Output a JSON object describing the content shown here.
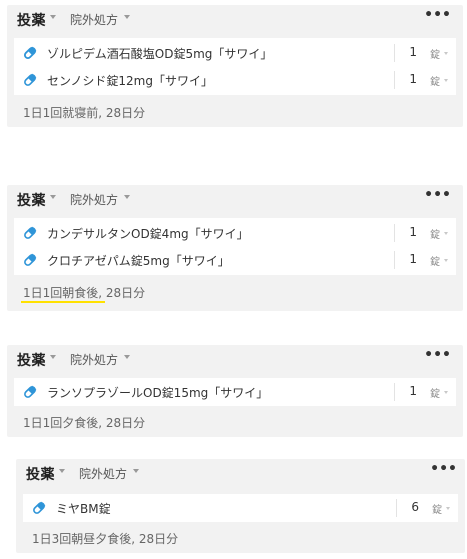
{
  "cards": [
    {
      "title": "投薬",
      "type": "院外処方",
      "more": "•••",
      "drugs": [
        {
          "icon": "pill-icon",
          "name": "ゾルピデム酒石酸塩OD錠5mg「サワイ」",
          "qty": "1",
          "unit": "錠"
        },
        {
          "icon": "pill-icon",
          "name": "センノシド錠12mg「サワイ」",
          "qty": "1",
          "unit": "錠"
        }
      ],
      "usage": "1日1回就寝前, 28日分"
    },
    {
      "title": "投薬",
      "type": "院外処方",
      "more": "•••",
      "drugs": [
        {
          "icon": "pill-icon",
          "name": "カンデサルタンOD錠4mg「サワイ」",
          "qty": "1",
          "unit": "錠"
        },
        {
          "icon": "pill-icon",
          "name": "クロチアゼパム錠5mg「サワイ」",
          "qty": "1",
          "unit": "錠"
        }
      ],
      "usage": "1日1回朝食後, 28日分",
      "highlight_color": "#ffe100"
    },
    {
      "title": "投薬",
      "type": "院外処方",
      "more": "•••",
      "drugs": [
        {
          "icon": "pill-icon",
          "name": "ランソプラゾールOD錠15mg「サワイ」",
          "qty": "1",
          "unit": "錠"
        }
      ],
      "usage": "1日1回夕食後, 28日分"
    },
    {
      "title": "投薬",
      "type": "院外処方",
      "more": "•••",
      "drugs": [
        {
          "icon": "pill-icon",
          "name": "ミヤBM錠",
          "qty": "6",
          "unit": "錠"
        }
      ],
      "usage": "1日3回朝昼夕食後, 28日分"
    }
  ],
  "colors": {
    "card_background": "#f2f2f2",
    "pill_icon": "#2f95d8",
    "highlight": "#ffe100"
  }
}
